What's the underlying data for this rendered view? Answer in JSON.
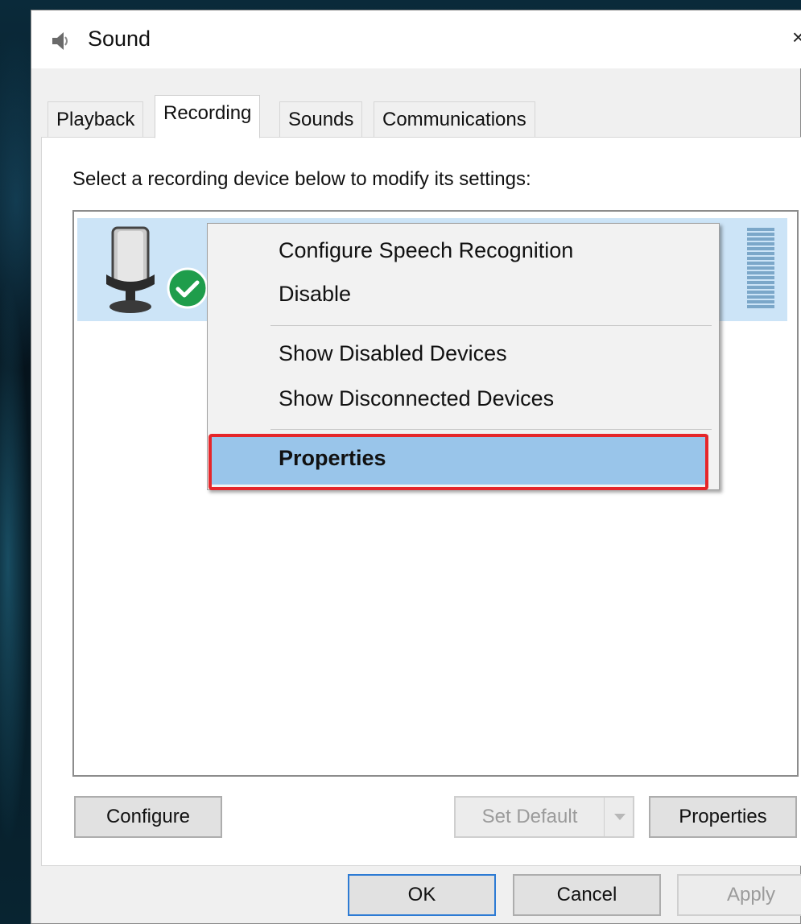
{
  "window": {
    "title": "Sound",
    "close_label": "×"
  },
  "tabs": [
    {
      "label": "Playback",
      "active": false
    },
    {
      "label": "Recording",
      "active": true
    },
    {
      "label": "Sounds",
      "active": false
    },
    {
      "label": "Communications",
      "active": false
    }
  ],
  "panel": {
    "instruction": "Select a recording device below to modify its settings:"
  },
  "device": {
    "status": "default-device-check"
  },
  "context_menu": {
    "items": [
      "Configure Speech Recognition",
      "Disable",
      "Show Disabled Devices",
      "Show Disconnected Devices",
      "Properties"
    ],
    "highlighted": "Properties"
  },
  "buttons": {
    "configure": "Configure",
    "set_default": "Set Default",
    "properties": "Properties",
    "ok": "OK",
    "cancel": "Cancel",
    "apply": "Apply"
  },
  "colors": {
    "selection": "#cce4f7",
    "menu_highlight": "#99c5ea",
    "callout": "#e5262a",
    "check_badge": "#1f9d4b"
  }
}
